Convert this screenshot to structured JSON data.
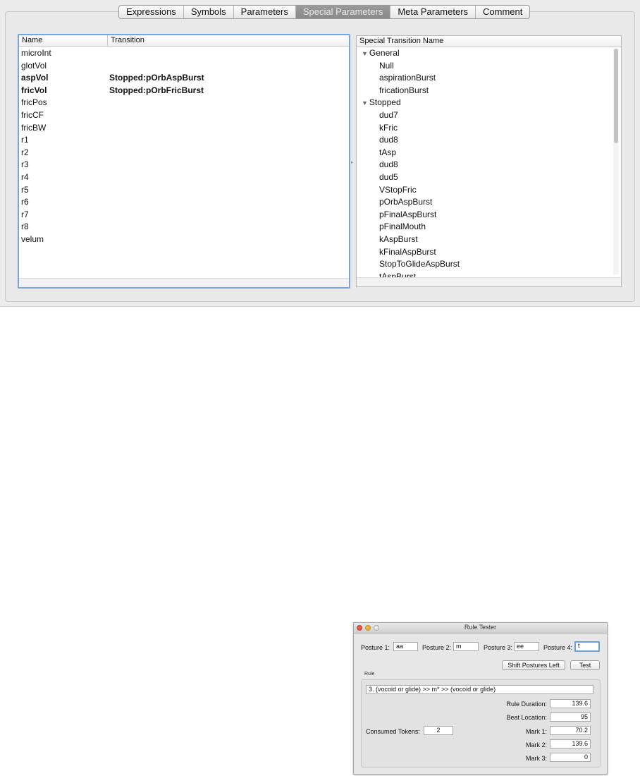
{
  "tabs": [
    {
      "label": "Expressions"
    },
    {
      "label": "Symbols"
    },
    {
      "label": "Parameters"
    },
    {
      "label": "Special Parameters"
    },
    {
      "label": "Meta Parameters"
    },
    {
      "label": "Comment"
    }
  ],
  "active_tab": "Special Parameters",
  "params_table": {
    "headers": {
      "name": "Name",
      "transition": "Transition"
    },
    "rows": [
      {
        "name": "microInt",
        "transition": ""
      },
      {
        "name": "glotVol",
        "transition": ""
      },
      {
        "name": "aspVol",
        "transition": "Stopped:pOrbAspBurst"
      },
      {
        "name": "fricVol",
        "transition": "Stopped:pOrbFricBurst"
      },
      {
        "name": "fricPos",
        "transition": ""
      },
      {
        "name": "fricCF",
        "transition": ""
      },
      {
        "name": "fricBW",
        "transition": ""
      },
      {
        "name": "r1",
        "transition": ""
      },
      {
        "name": "r2",
        "transition": ""
      },
      {
        "name": "r3",
        "transition": ""
      },
      {
        "name": "r4",
        "transition": ""
      },
      {
        "name": "r5",
        "transition": ""
      },
      {
        "name": "r6",
        "transition": ""
      },
      {
        "name": "r7",
        "transition": ""
      },
      {
        "name": "r8",
        "transition": ""
      },
      {
        "name": "velum",
        "transition": ""
      }
    ]
  },
  "transitions_tree": {
    "header": "Special Transition Name",
    "groups": [
      {
        "label": "General",
        "items": [
          "Null",
          "aspirationBurst",
          "fricationBurst"
        ]
      },
      {
        "label": "Stopped",
        "items": [
          "dud7",
          "kFric",
          "dud8",
          "tAsp",
          "dud8",
          "dud5",
          "VStopFric",
          "pOrbAspBurst",
          "pFinalAspBurst",
          "pFinalMouth",
          "kAspBurst",
          "kFinalAspBurst",
          "StopToGlideAspBurst",
          "tAspBurst"
        ]
      }
    ]
  },
  "rule_tester": {
    "title": "Rule Tester",
    "posture1_label": "Posture 1:",
    "posture1_value": "aa",
    "posture2_label": "Posture 2:",
    "posture2_value": "m",
    "posture3_label": "Posture 3:",
    "posture3_value": "ee",
    "posture4_label": "Posture 4:",
    "posture4_value": "t",
    "shift_button": "Shift Postures Left",
    "test_button": "Test",
    "rule_caption": "Rule",
    "rule_text": "3. (vocoid or glide) >> m* >> (vocoid or glide)",
    "rule_duration_label": "Rule Duration:",
    "rule_duration_value": "139.6",
    "beat_location_label": "Beat Location:",
    "beat_location_value": "95",
    "consumed_tokens_label": "Consumed Tokens:",
    "consumed_tokens_value": "2",
    "mark1_label": "Mark 1:",
    "mark1_value": "70.2",
    "mark2_label": "Mark 2:",
    "mark2_value": "139.6",
    "mark3_label": "Mark 3:",
    "mark3_value": "0"
  }
}
